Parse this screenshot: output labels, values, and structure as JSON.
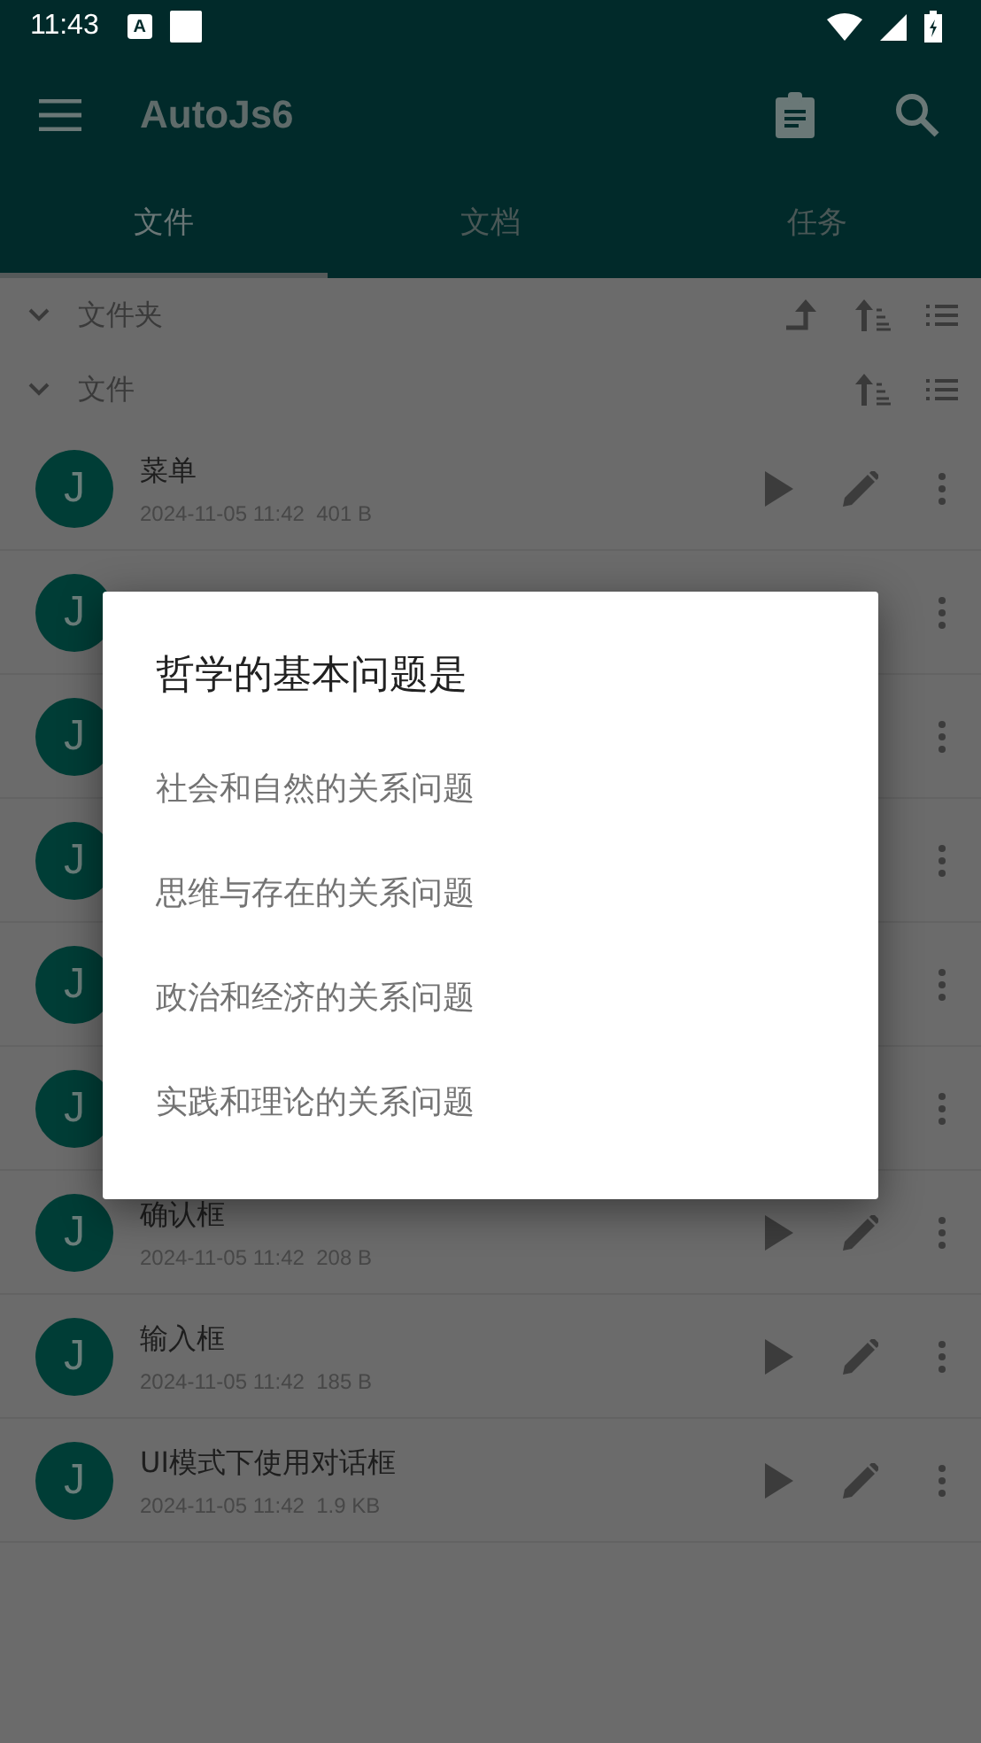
{
  "status_bar": {
    "time": "11:43",
    "notification_letter": "A"
  },
  "toolbar": {
    "title": "AutoJs6"
  },
  "tabs": [
    {
      "label": "文件",
      "selected": true
    },
    {
      "label": "文档",
      "selected": false
    },
    {
      "label": "任务",
      "selected": false
    }
  ],
  "sections": [
    {
      "title": "文件夹",
      "kind": "folders"
    },
    {
      "title": "文件",
      "kind": "files"
    }
  ],
  "rows": [
    {
      "avatar": "J",
      "title": "菜单",
      "meta": "2024-11-05 11:42  401 B"
    },
    {
      "avatar": "J"
    },
    {
      "avatar": "J"
    },
    {
      "avatar": "J"
    },
    {
      "avatar": "J"
    },
    {
      "avatar": "J"
    },
    {
      "avatar": "J",
      "title": "确认框",
      "meta": "2024-11-05 11:42  208 B"
    },
    {
      "avatar": "J",
      "title": "输入框",
      "meta": "2024-11-05 11:42  185 B"
    },
    {
      "avatar": "J",
      "title": "UI模式下使用对话框",
      "meta": "2024-11-05 11:42  1.9 KB"
    }
  ],
  "dialog": {
    "title": "哲学的基本问题是",
    "options": [
      "社会和自然的关系问题",
      "思维与存在的关系问题",
      "政治和经济的关系问题",
      "实践和理论的关系问题"
    ]
  }
}
